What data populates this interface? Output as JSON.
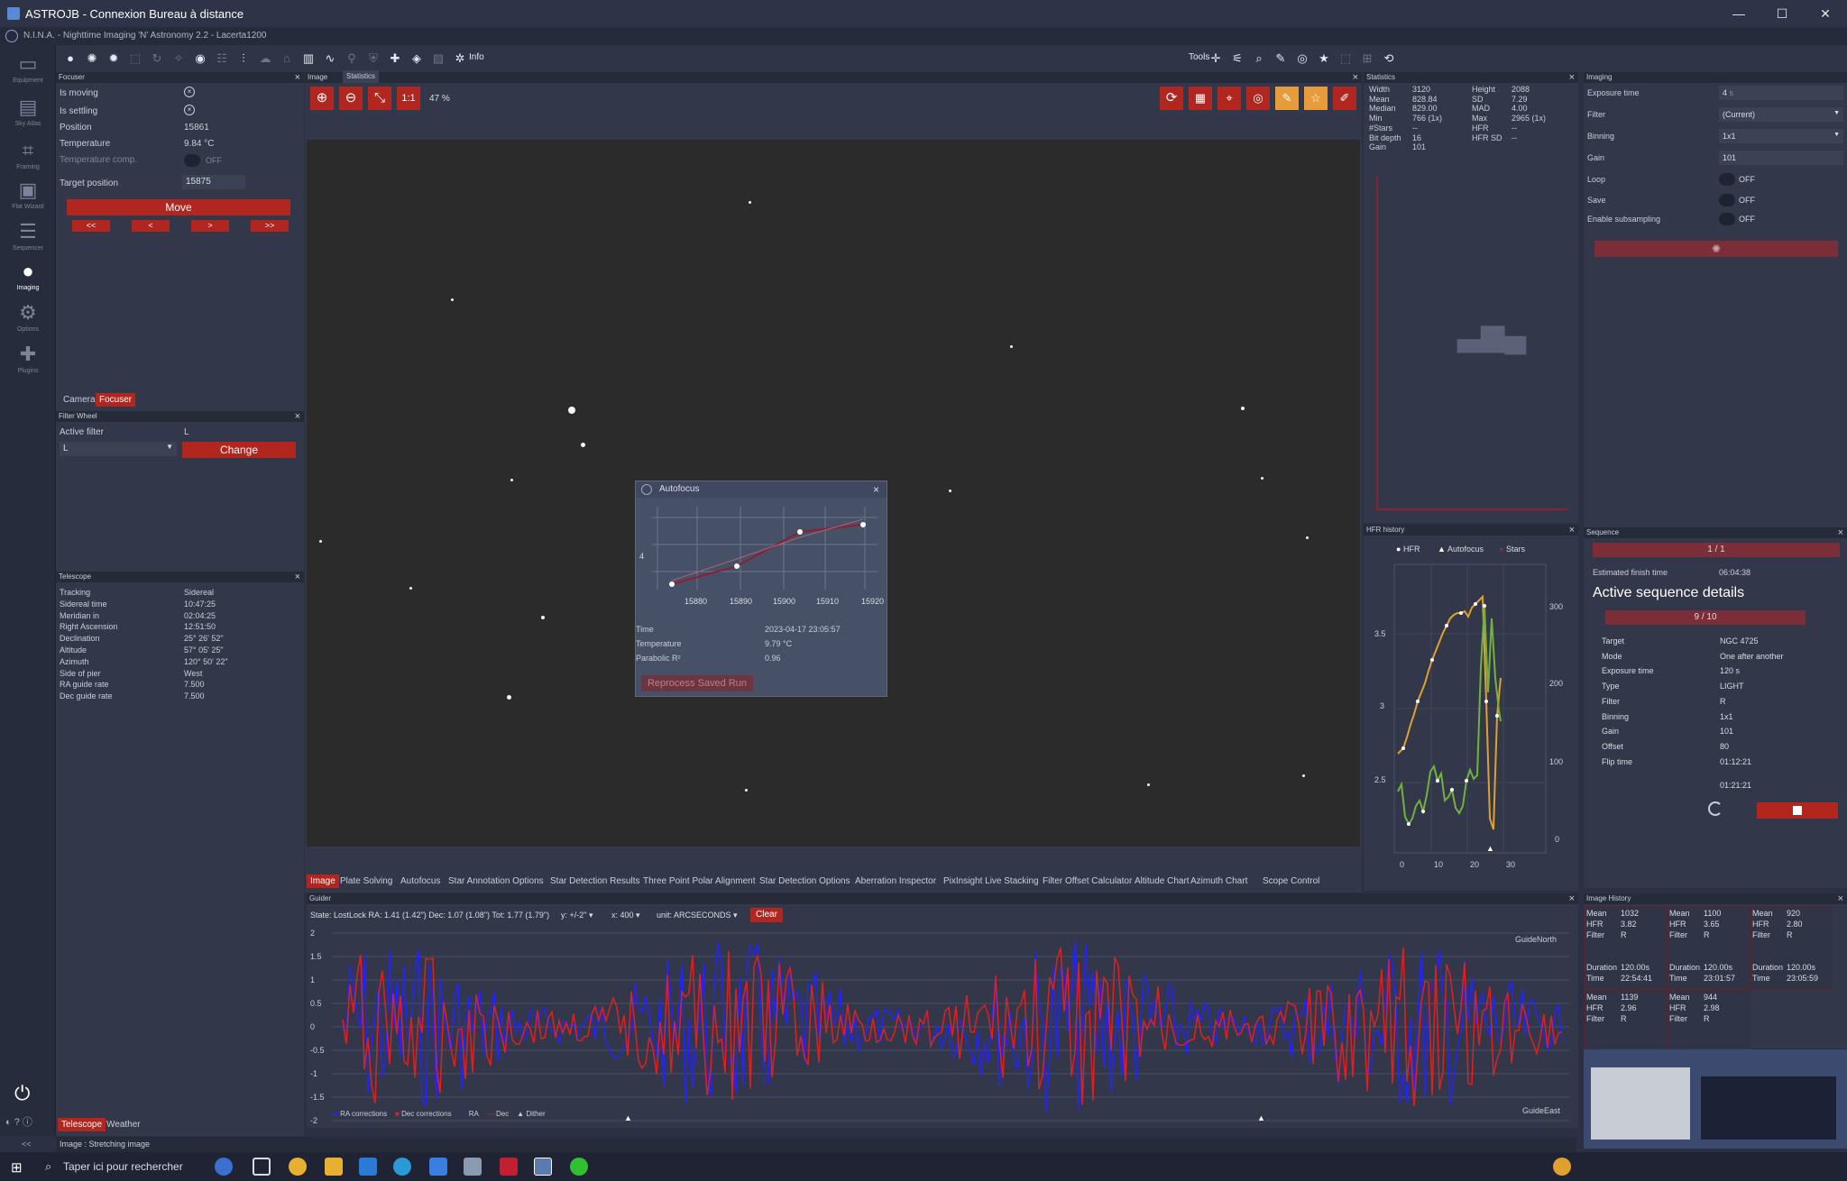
{
  "window": {
    "title": "ASTROJB - Connexion Bureau à distance"
  },
  "app": {
    "title": "N.I.N.A. - Nighttime Imaging 'N' Astronomy 2.2",
    "profile": "Lacerta1200"
  },
  "toolbar": {
    "info_label": "Info",
    "tools_label": "Tools"
  },
  "nav": [
    {
      "label": "Equipment",
      "icon": "telescope-icon"
    },
    {
      "label": "Sky Atlas",
      "icon": "atlas-icon"
    },
    {
      "label": "Framing",
      "icon": "framing-icon"
    },
    {
      "label": "Flat Wizard",
      "icon": "flat-icon"
    },
    {
      "label": "Sequencer",
      "icon": "sequencer-icon"
    },
    {
      "label": "Imaging",
      "icon": "imaging-icon"
    },
    {
      "label": "Options",
      "icon": "gear-icon"
    },
    {
      "label": "Plugins",
      "icon": "puzzle-icon"
    }
  ],
  "focuser": {
    "title": "Focuser",
    "is_moving_label": "Is moving",
    "is_settling_label": "Is settling",
    "position_label": "Position",
    "position": "15861",
    "temperature_label": "Temperature",
    "temperature": "9.84 °C",
    "temp_comp_label": "Temperature comp.",
    "temp_comp": "OFF",
    "target_label": "Target position",
    "target": "15875",
    "move_label": "Move",
    "step_buttons": [
      "<<",
      "<",
      ">",
      ">>"
    ]
  },
  "left_tabs": {
    "camera": "Camera",
    "focuser": "Focuser"
  },
  "filter_wheel": {
    "title": "Filter Wheel",
    "active_label": "Active filter",
    "active": "L",
    "selected": "L",
    "change_label": "Change"
  },
  "telescope": {
    "title": "Telescope",
    "rows": [
      {
        "k": "Tracking",
        "v": "Sidereal"
      },
      {
        "k": "Sidereal time",
        "v": "10:47:25"
      },
      {
        "k": "Meridian in",
        "v": "02:04:25"
      },
      {
        "k": "Right Ascension",
        "v": "12:51:50"
      },
      {
        "k": "Declination",
        "v": "25° 26' 52\""
      },
      {
        "k": "Altitude",
        "v": "57° 05' 25\""
      },
      {
        "k": "Azimuth",
        "v": "120° 50' 22\""
      },
      {
        "k": "Side of pier",
        "v": "West"
      },
      {
        "k": "RA guide rate",
        "v": "7.500"
      },
      {
        "k": "Dec guide rate",
        "v": "7.500"
      }
    ]
  },
  "bottom_left_tabs": {
    "telescope": "Telescope",
    "weather": "Weather"
  },
  "image_panel": {
    "title": "Image",
    "stats_tab": "Statistics",
    "one_to_one": "1:1",
    "zoom": "47 %"
  },
  "image_tabs": [
    "Image",
    "Plate Solving",
    "Autofocus",
    "Star Annotation Options",
    "Star Detection Results",
    "Three Point Polar Alignment",
    "Star Detection Options",
    "Aberration Inspector",
    "PixInsight Live Stacking",
    "Filter Offset Calculator",
    "Altitude Chart",
    "Azimuth Chart",
    "Scope Control"
  ],
  "statistics": {
    "title": "Statistics",
    "left": [
      {
        "k": "Width",
        "v": "3120"
      },
      {
        "k": "Mean",
        "v": "828.84"
      },
      {
        "k": "Median",
        "v": "829.00"
      },
      {
        "k": "Min",
        "v": "766 (1x)"
      },
      {
        "k": "#Stars",
        "v": "--"
      },
      {
        "k": "Bit depth",
        "v": "16"
      },
      {
        "k": "Gain",
        "v": "101"
      }
    ],
    "right": [
      {
        "k": "Height",
        "v": "2088"
      },
      {
        "k": "SD",
        "v": "7.29"
      },
      {
        "k": "MAD",
        "v": "4.00"
      },
      {
        "k": "Max",
        "v": "2965 (1x)"
      },
      {
        "k": "HFR",
        "v": "--"
      },
      {
        "k": "HFR SD",
        "v": "--"
      }
    ]
  },
  "imaging": {
    "title": "Imaging",
    "exposure_label": "Exposure time",
    "exposure": "4",
    "filter_label": "Filter",
    "filter": "(Current)",
    "binning_label": "Binning",
    "binning": "1x1",
    "gain_label": "Gain",
    "gain": "101",
    "loop_label": "Loop",
    "loop": "OFF",
    "save_label": "Save",
    "save": "OFF",
    "subsampling_label": "Enable subsampling",
    "subsampling": "OFF"
  },
  "hfr_history": {
    "title": "HFR history",
    "legend": [
      "HFR",
      "Autofocus",
      "Stars"
    ],
    "y_left_ticks": [
      "3.5",
      "3",
      "2.5"
    ],
    "y_right_ticks": [
      "300",
      "200",
      "100",
      "0"
    ],
    "x_ticks": [
      "0",
      "10",
      "20",
      "30"
    ]
  },
  "sequence": {
    "title": "Sequence",
    "progress": "1 / 1",
    "finish_label": "Estimated finish time",
    "finish": "06:04:38",
    "active_title": "Active sequence details",
    "item_progress": "9 / 10",
    "rows": [
      {
        "k": "Target",
        "v": "NGC 4725"
      },
      {
        "k": "Mode",
        "v": "One after another"
      },
      {
        "k": "Exposure time",
        "v": "120 s"
      },
      {
        "k": "Type",
        "v": "LIGHT"
      },
      {
        "k": "Filter",
        "v": "R"
      },
      {
        "k": "Binning",
        "v": "1x1"
      },
      {
        "k": "Gain",
        "v": "101"
      },
      {
        "k": "Offset",
        "v": "80"
      },
      {
        "k": "Flip time",
        "v": "01:12:21"
      }
    ],
    "countdown": "01:21:21"
  },
  "autofocus": {
    "title": "Autofocus",
    "x_ticks": [
      "15880",
      "15890",
      "15900",
      "15910",
      "15920"
    ],
    "y_tick": "4",
    "time_label": "Time",
    "time": "2023-04-17 23:05:57",
    "temp_label": "Temperature",
    "temp": "9.79 °C",
    "r2_label": "Parabolic R²",
    "r2": "0.96",
    "reprocess_label": "Reprocess Saved Run"
  },
  "guider": {
    "title": "Guider",
    "state": "State: LostLock  RA: 1.41 (1.42\")  Dec: 1.07 (1.08\")  Tot: 1.77 (1.79\")",
    "y_scale": "y: +/-2\"",
    "x_scale": "x: 400",
    "unit": "unit: ARCSECONDS",
    "clear_label": "Clear",
    "y_ticks": [
      "2",
      "1.5",
      "1",
      "0.5",
      "0",
      "-0.5",
      "-1",
      "-1.5",
      "-2"
    ],
    "legend": [
      "RA corrections",
      "Dec corrections",
      "RA",
      "Dec",
      "Dither"
    ],
    "north_label": "GuideNorth",
    "east_label": "GuideEast"
  },
  "image_history": {
    "title": "Image History",
    "cells": [
      {
        "mean": "1032",
        "hfr": "3.82",
        "filter": "R",
        "duration": "120.00s",
        "time": "22:54:41"
      },
      {
        "mean": "1100",
        "hfr": "3.65",
        "filter": "R",
        "duration": "120.00s",
        "time": "23:01:57"
      },
      {
        "mean": "920",
        "hfr": "2.80",
        "filter": "R",
        "duration": "120.00s",
        "time": "23:05:59"
      },
      {
        "mean": "1139",
        "hfr": "2.96",
        "filter": "R"
      },
      {
        "mean": "944",
        "hfr": "2.98",
        "filter": "R"
      }
    ],
    "labels": {
      "mean": "Mean",
      "hfr": "HFR",
      "filter": "Filter",
      "duration": "Duration",
      "time": "Time"
    }
  },
  "status": {
    "text": "Image :  Stretching image"
  },
  "taskbar": {
    "search_placeholder": "Taper ici pour rechercher"
  },
  "colors": {
    "accent": "#b1261f",
    "panel": "#323849",
    "bg": "#2b3142",
    "ra": "#2323ff",
    "dec": "#e02020"
  }
}
